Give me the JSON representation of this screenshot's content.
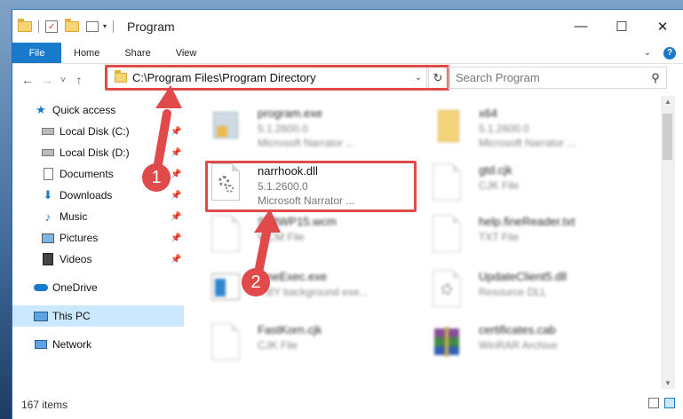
{
  "window": {
    "title": "Program",
    "controls": [
      "—",
      "☐",
      "✕"
    ]
  },
  "ribbon": {
    "tabs": [
      "File",
      "Home",
      "Share",
      "View"
    ],
    "expand_icon": "chevron-down-icon"
  },
  "nav": {
    "back": "←",
    "forward": "→",
    "recent": "˅",
    "up": "↑"
  },
  "address": {
    "path": "C:\\Program Files\\Program Directory",
    "refresh": "↻"
  },
  "search": {
    "placeholder": "Search Program"
  },
  "sidebar": [
    {
      "label": "Quick access",
      "icon": "star-icon"
    },
    {
      "label": "Local Disk (C:)",
      "icon": "drive-icon"
    },
    {
      "label": "Local Disk (D:)",
      "icon": "drive-icon"
    },
    {
      "label": "Documents",
      "icon": "documents-icon"
    },
    {
      "label": "Downloads",
      "icon": "downloads-icon"
    },
    {
      "label": "Music",
      "icon": "music-icon"
    },
    {
      "label": "Pictures",
      "icon": "pictures-icon"
    },
    {
      "label": "Videos",
      "icon": "videos-icon"
    },
    {
      "label": "OneDrive",
      "icon": "onedrive-icon"
    },
    {
      "label": "This PC",
      "icon": "computer-icon"
    },
    {
      "label": "Network",
      "icon": "network-icon"
    }
  ],
  "files": [
    {
      "name": "program.exe",
      "line2": "5.1.2600.0",
      "line3": "Microsoft Narrator ...",
      "icon": "exe-icon"
    },
    {
      "name": "x64",
      "line2": "5.1.2600.0",
      "line3": "Microsoft Narrator ...",
      "icon": "folder-icon"
    },
    {
      "name": "narrhook.dll",
      "line2": "5.1.2600.0",
      "line3": "Microsoft Narrator ...",
      "icon": "dll-gear-icon"
    },
    {
      "name": "gtd.cjk",
      "line2": "CJK File",
      "line3": "",
      "icon": "file-icon"
    },
    {
      "name": "SoftWP15.wcm",
      "line2": "WCM File",
      "line3": "",
      "icon": "file-icon"
    },
    {
      "name": "help.fineReader.txt",
      "line2": "TXT File",
      "line3": "",
      "icon": "file-icon"
    },
    {
      "name": "OneExec.exe",
      "line2": "...BY background exe...",
      "line3": "",
      "icon": "exe-icon"
    },
    {
      "name": "UpdateClient5.dll",
      "line2": "Resource DLL",
      "line3": "",
      "icon": "dll-gear-icon"
    },
    {
      "name": "FastKorn.cjk",
      "line2": "CJK File",
      "line3": "",
      "icon": "file-icon"
    },
    {
      "name": "certificates.cab",
      "line2": "WinRAR Archive",
      "line3": "",
      "icon": "winrar-icon"
    }
  ],
  "status": {
    "count": "167 items"
  },
  "callouts": [
    "1",
    "2"
  ],
  "colors": {
    "accent": "#1979ca",
    "highlight": "#e04a4a",
    "selected": "#cce8ff"
  }
}
